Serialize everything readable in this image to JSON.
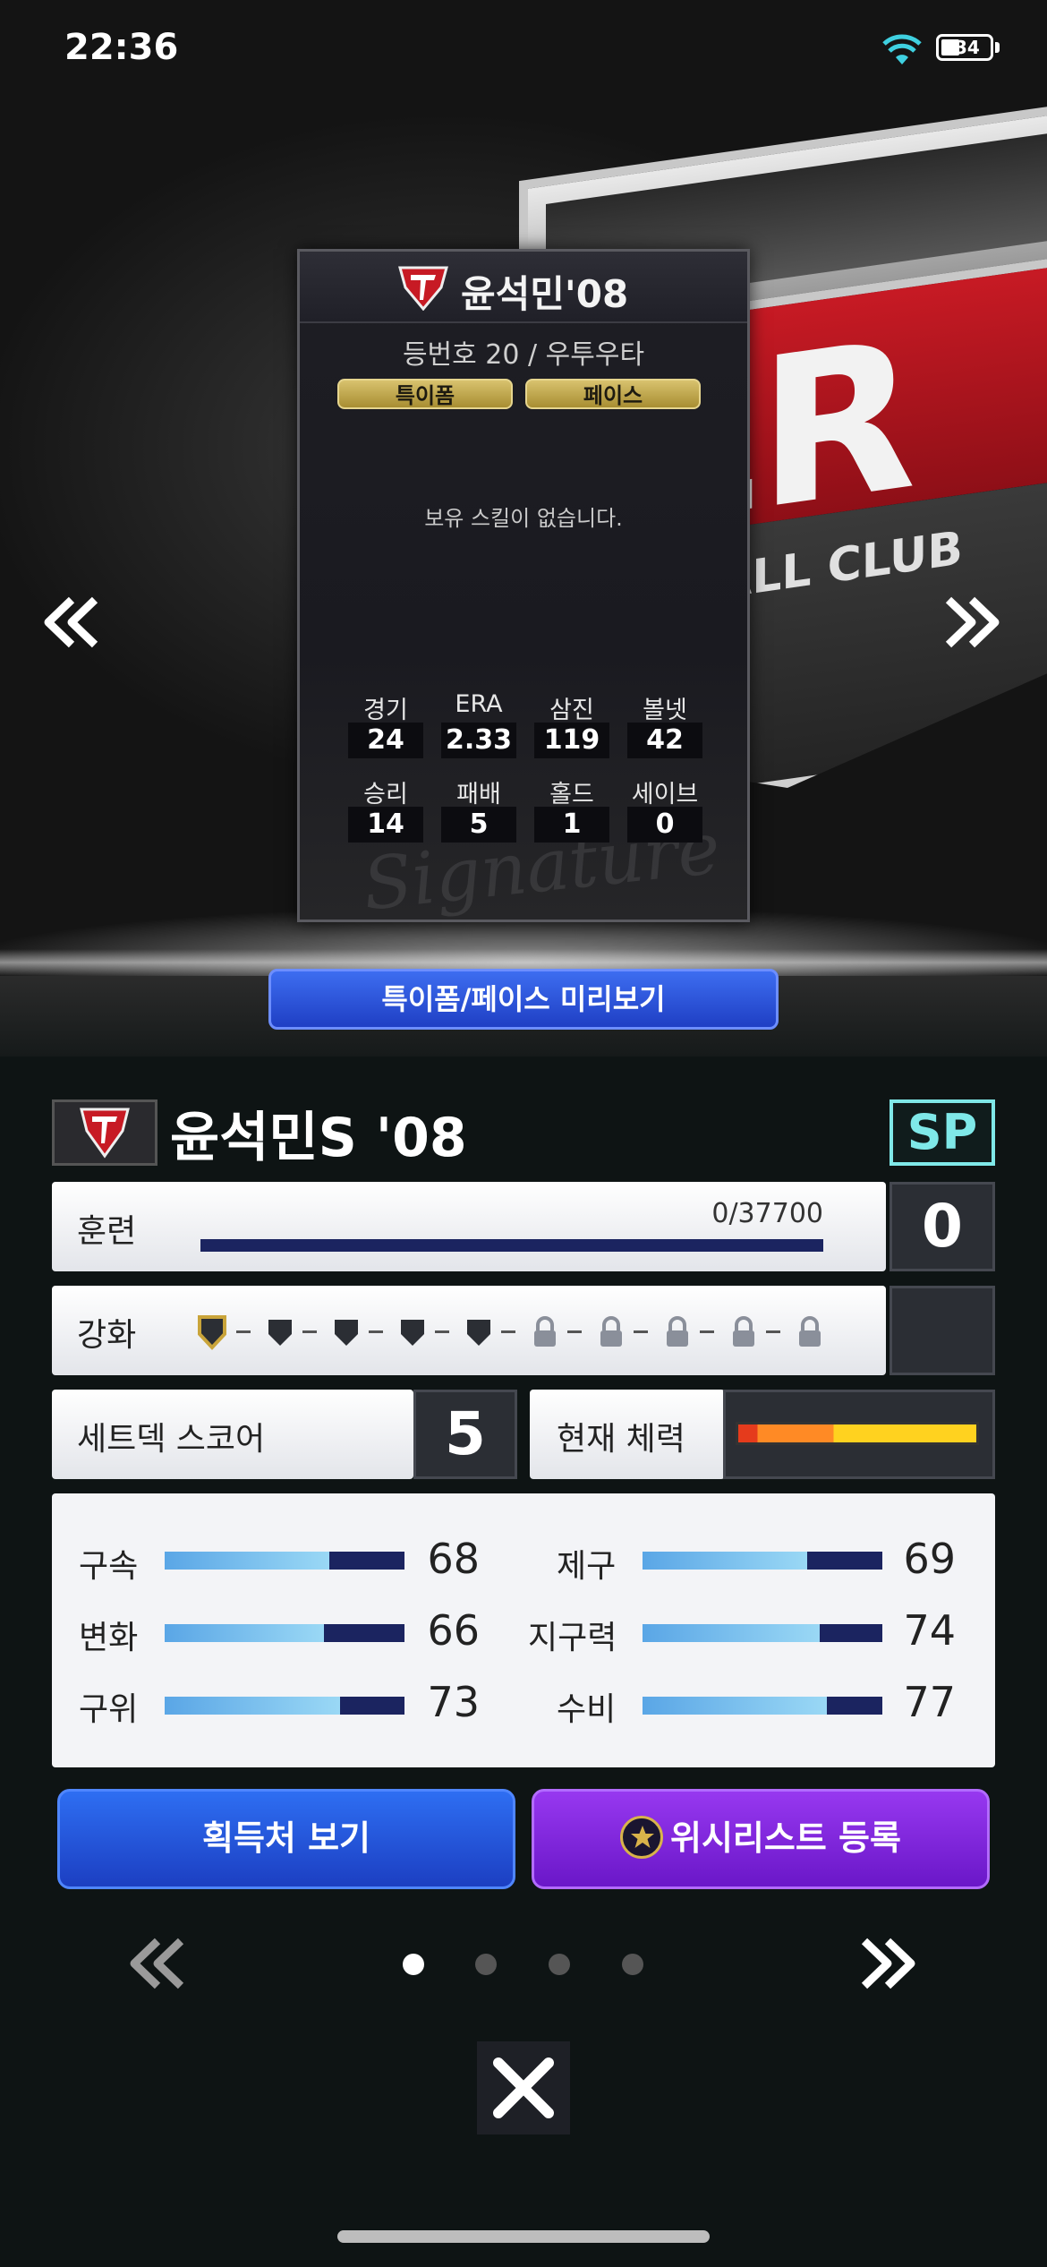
{
  "status_bar": {
    "time": "22:36",
    "battery": "34"
  },
  "card": {
    "name": "윤석민'08",
    "subtitle": "등번호 20 / 우투우타",
    "chips": [
      "특이폼",
      "페이스"
    ],
    "no_skill": "보유 스킬이 없습니다.",
    "signature_text": "Signature",
    "stats": [
      {
        "label": "경기",
        "value": "24"
      },
      {
        "label": "ERA",
        "value": "2.33"
      },
      {
        "label": "삼진",
        "value": "119"
      },
      {
        "label": "볼넷",
        "value": "42"
      },
      {
        "label": "승리",
        "value": "14"
      },
      {
        "label": "패배",
        "value": "5"
      },
      {
        "label": "홀드",
        "value": "1"
      },
      {
        "label": "세이브",
        "value": "0"
      }
    ]
  },
  "background_logo": {
    "letters": "ER",
    "club_text": "ALL CLUB"
  },
  "preview_button": "특이폼/페이스 미리보기",
  "player": {
    "name": "윤석민S '08",
    "badge": "SP"
  },
  "training": {
    "label": "훈련",
    "progress": "0/37700",
    "progress_fraction": 0,
    "level": "0"
  },
  "enhance": {
    "label": "강화",
    "levels_total": 10,
    "levels_unlocked": 5
  },
  "setdeck": {
    "label": "세트덱 스코어",
    "value": "5"
  },
  "stamina": {
    "label": "현재 체력"
  },
  "abilities": [
    {
      "label": "구속",
      "value": "68"
    },
    {
      "label": "제구",
      "value": "69"
    },
    {
      "label": "변화",
      "value": "66"
    },
    {
      "label": "지구력",
      "value": "74"
    },
    {
      "label": "구위",
      "value": "73"
    },
    {
      "label": "수비",
      "value": "77"
    }
  ],
  "buttons": {
    "acquire": "획득처 보기",
    "wishlist": "위시리스트 등록"
  },
  "pagination": {
    "total": 4,
    "current": 1
  },
  "colors": {
    "accent_blue": "#2e6ef2",
    "accent_purple": "#9738f0",
    "sp_badge": "#7fe8e8",
    "team_red": "#c71a24"
  }
}
